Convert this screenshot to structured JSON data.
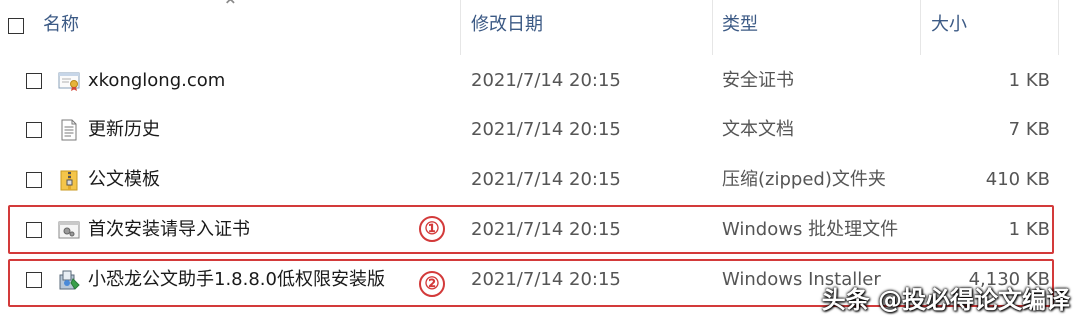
{
  "columns": {
    "name": "名称",
    "date": "修改日期",
    "type": "类型",
    "size": "大小"
  },
  "files": [
    {
      "name": "xkonglong.com",
      "date": "2021/7/14 20:15",
      "type": "安全证书",
      "size": "1 KB",
      "icon": "certificate-icon"
    },
    {
      "name": "更新历史",
      "date": "2021/7/14 20:15",
      "type": "文本文档",
      "size": "7 KB",
      "icon": "text-document-icon"
    },
    {
      "name": "公文模板",
      "date": "2021/7/14 20:15",
      "type": "压缩(zipped)文件夹",
      "size": "410 KB",
      "icon": "zip-folder-icon"
    },
    {
      "name": "首次安装请导入证书",
      "date": "2021/7/14 20:15",
      "type": "Windows 批处理文件",
      "size": "1 KB",
      "icon": "batch-file-icon"
    },
    {
      "name": "小恐龙公文助手1.8.8.0低权限安装版",
      "date": "2021/7/14 20:15",
      "type": "Windows Installer",
      "size": "4,130 KB",
      "icon": "installer-icon"
    }
  ],
  "badges": [
    "①",
    "②"
  ],
  "watermark": "头条 @投必得论文编译",
  "colors": {
    "highlight_red": "#d33a3a",
    "header_text": "#3c5a85"
  }
}
